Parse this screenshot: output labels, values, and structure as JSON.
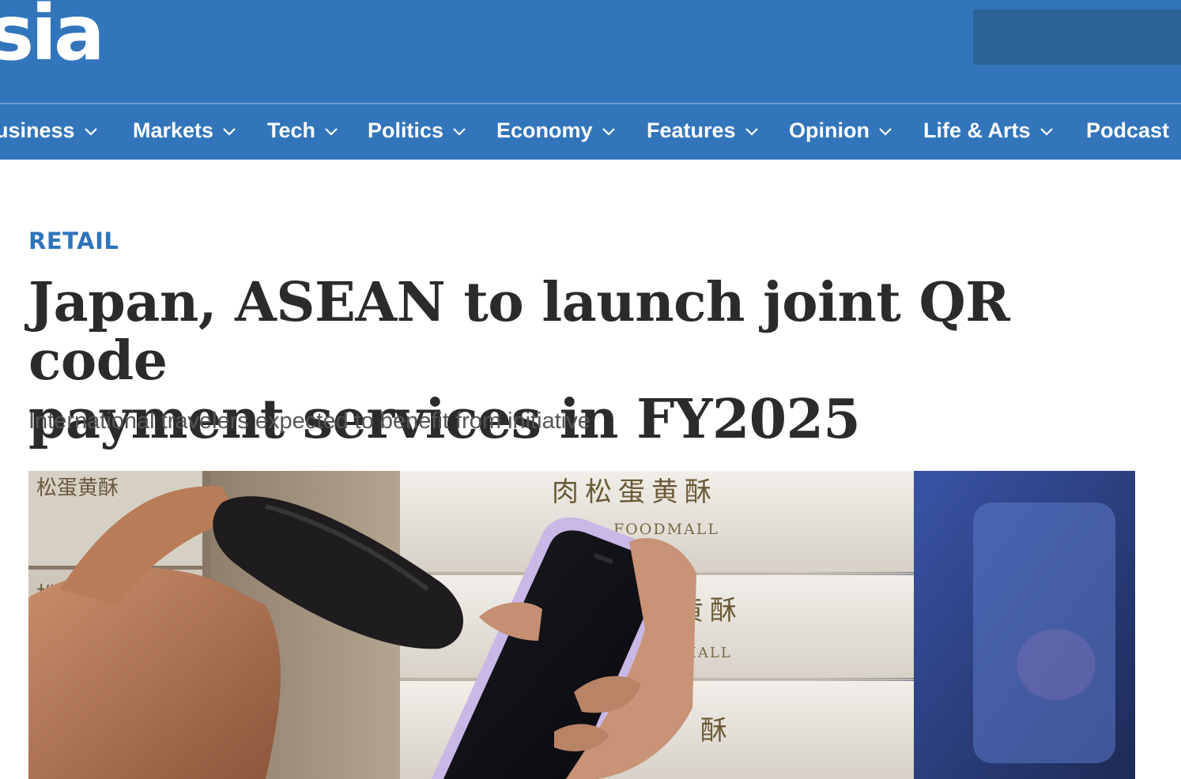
{
  "header": {
    "logo_text": "sia",
    "brand_color": "#3275bb"
  },
  "nav": {
    "items": [
      {
        "label": "usiness",
        "has_dropdown": true
      },
      {
        "label": "Markets",
        "has_dropdown": true
      },
      {
        "label": "Tech",
        "has_dropdown": true
      },
      {
        "label": "Politics",
        "has_dropdown": true
      },
      {
        "label": "Economy",
        "has_dropdown": true
      },
      {
        "label": "Features",
        "has_dropdown": true
      },
      {
        "label": "Opinion",
        "has_dropdown": true
      },
      {
        "label": "Life & Arts",
        "has_dropdown": true
      },
      {
        "label": "Podcast",
        "has_dropdown": false
      }
    ]
  },
  "article": {
    "category": "RETAIL",
    "headline_line1": "Japan, ASEAN to launch joint QR code",
    "headline_line2": "payment services in FY2025",
    "subheadline": "International travelers expected to benefit from initiative"
  },
  "hero_image": {
    "box_text_1": "肉松蛋黄酥",
    "box_text_2": "FOODMALL",
    "box_text_3": "黄酥",
    "box_text_4": "DMALL",
    "box_text_5": "酥",
    "box_text_6": "松蛋黄酥",
    "box_text_7": "松蛋"
  }
}
